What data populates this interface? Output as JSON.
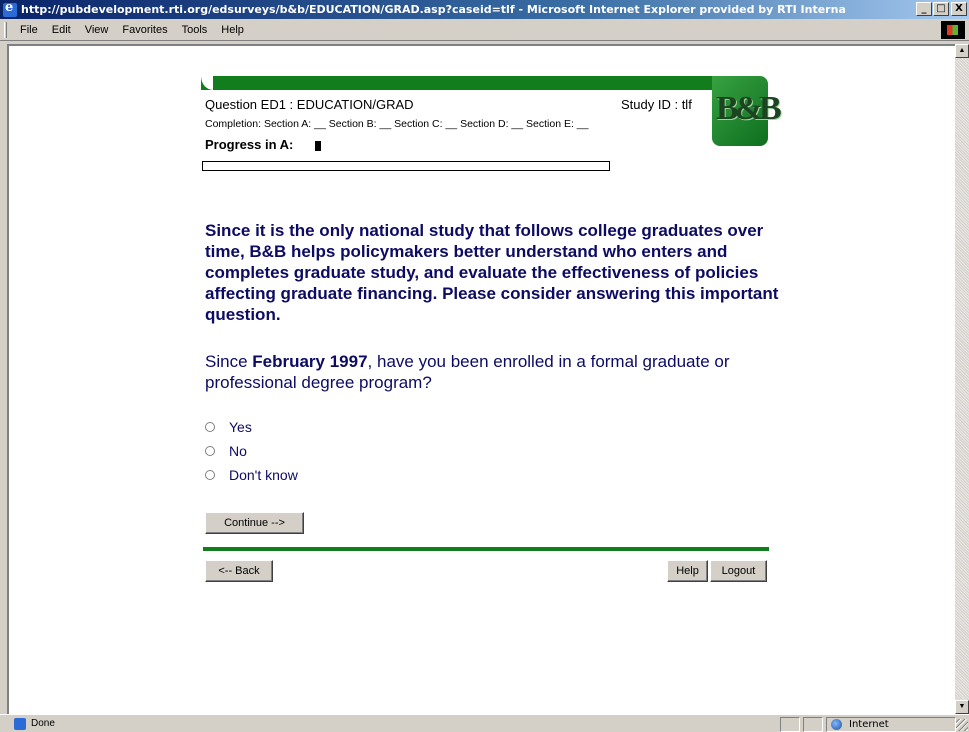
{
  "window": {
    "title": "http://pubdevelopment.rti.org/edsurveys/b&b/EDUCATION/GRAD.asp?caseid=tlf - Microsoft Internet Explorer provided by RTI Interna",
    "minimize": "_",
    "maximize": "□",
    "close": "X"
  },
  "menu": [
    "File",
    "Edit",
    "View",
    "Favorites",
    "Tools",
    "Help"
  ],
  "survey": {
    "logo_text": "B&B",
    "question_id": "Question ED1 : EDUCATION/GRAD",
    "study_id": "Study ID : tlf",
    "completion": "Completion:  Section A: __  Section B: __  Section C: __  Section D: __  Section E: __",
    "progress_label": "Progress in A:",
    "progress_fraction": 0.015,
    "intro": "Since it is the only national study that follows college graduates over time, B&B helps policymakers better understand who enters and completes graduate study, and evaluate the effectiveness of policies affecting graduate financing. Please consider answering this important question.",
    "question_prefix": "Since ",
    "question_bold": "February 1997",
    "question_suffix": ", have you been enrolled in a formal graduate or professional degree program?",
    "options": [
      "Yes",
      "No",
      "Don't know"
    ],
    "continue_label": "Continue -->",
    "back_label": "<-- Back",
    "help_label": "Help",
    "logout_label": "Logout"
  },
  "statusbar": {
    "status": "Done",
    "zone": "Internet"
  },
  "colors": {
    "accent_green": "#127d1c",
    "text_navy": "#0d0b63"
  }
}
